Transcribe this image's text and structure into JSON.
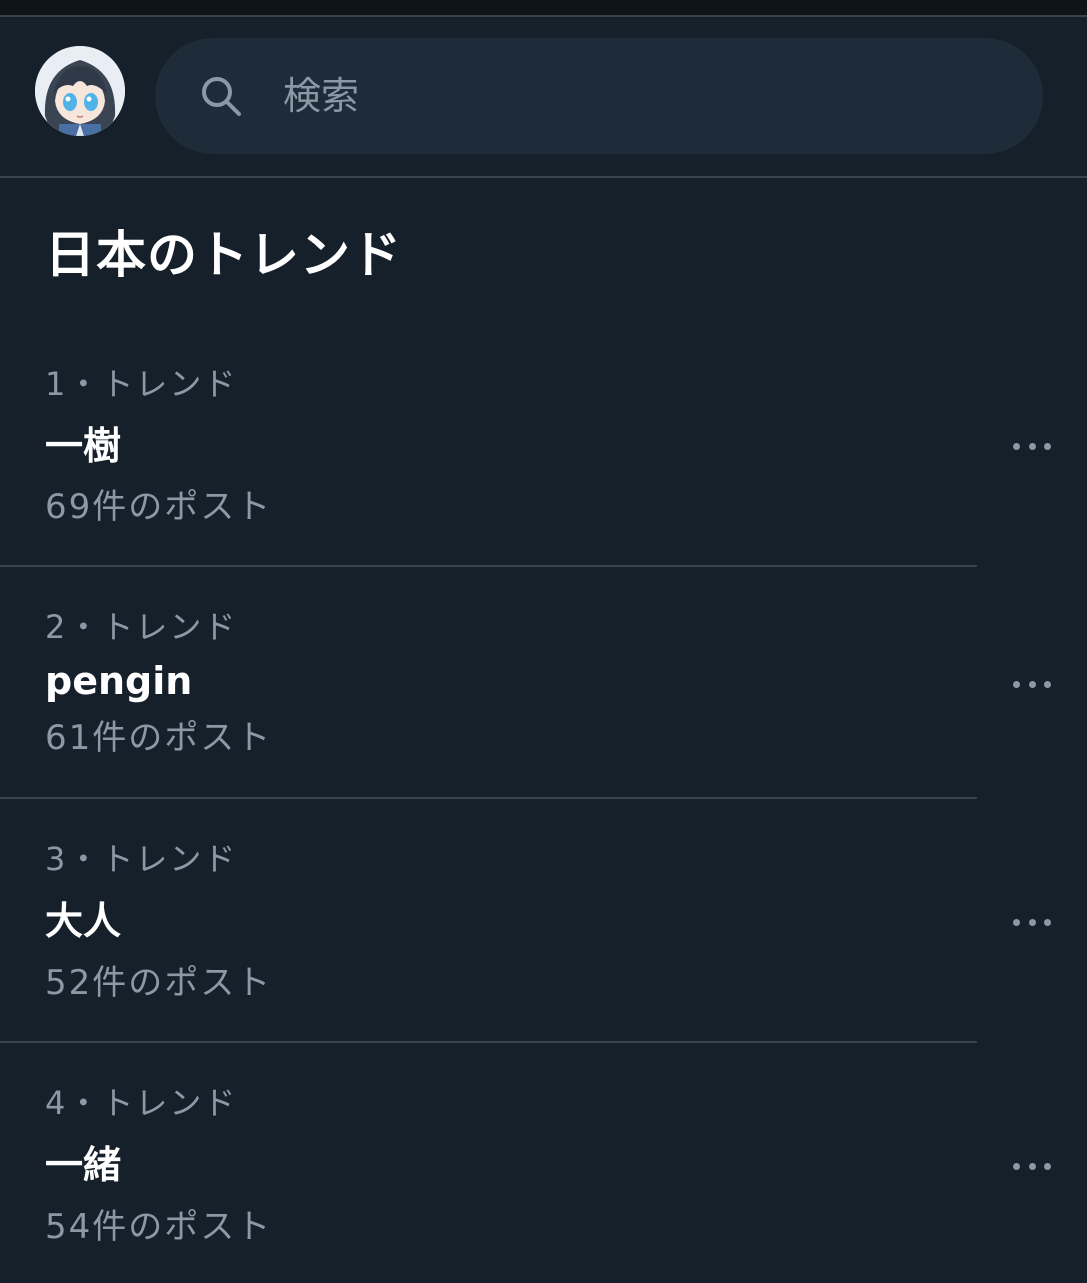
{
  "search": {
    "placeholder": "検索"
  },
  "section": {
    "title": "日本のトレンド"
  },
  "trends": [
    {
      "meta": "1・トレンド",
      "name": "一樹",
      "count": "69件のポスト"
    },
    {
      "meta": "2・トレンド",
      "name": "pengin",
      "count": "61件のポスト"
    },
    {
      "meta": "3・トレンド",
      "name": "大人",
      "count": "52件のポスト"
    },
    {
      "meta": "4・トレンド",
      "name": "一緒",
      "count": "54件のポスト"
    }
  ],
  "icons": {
    "search": "search-icon",
    "more": "more-dots-icon",
    "avatar": "profile-avatar"
  },
  "colors": {
    "background": "#15202b",
    "search_bg": "#1e2c3a",
    "muted_text": "#8b98a5",
    "divider": "#38444d"
  }
}
